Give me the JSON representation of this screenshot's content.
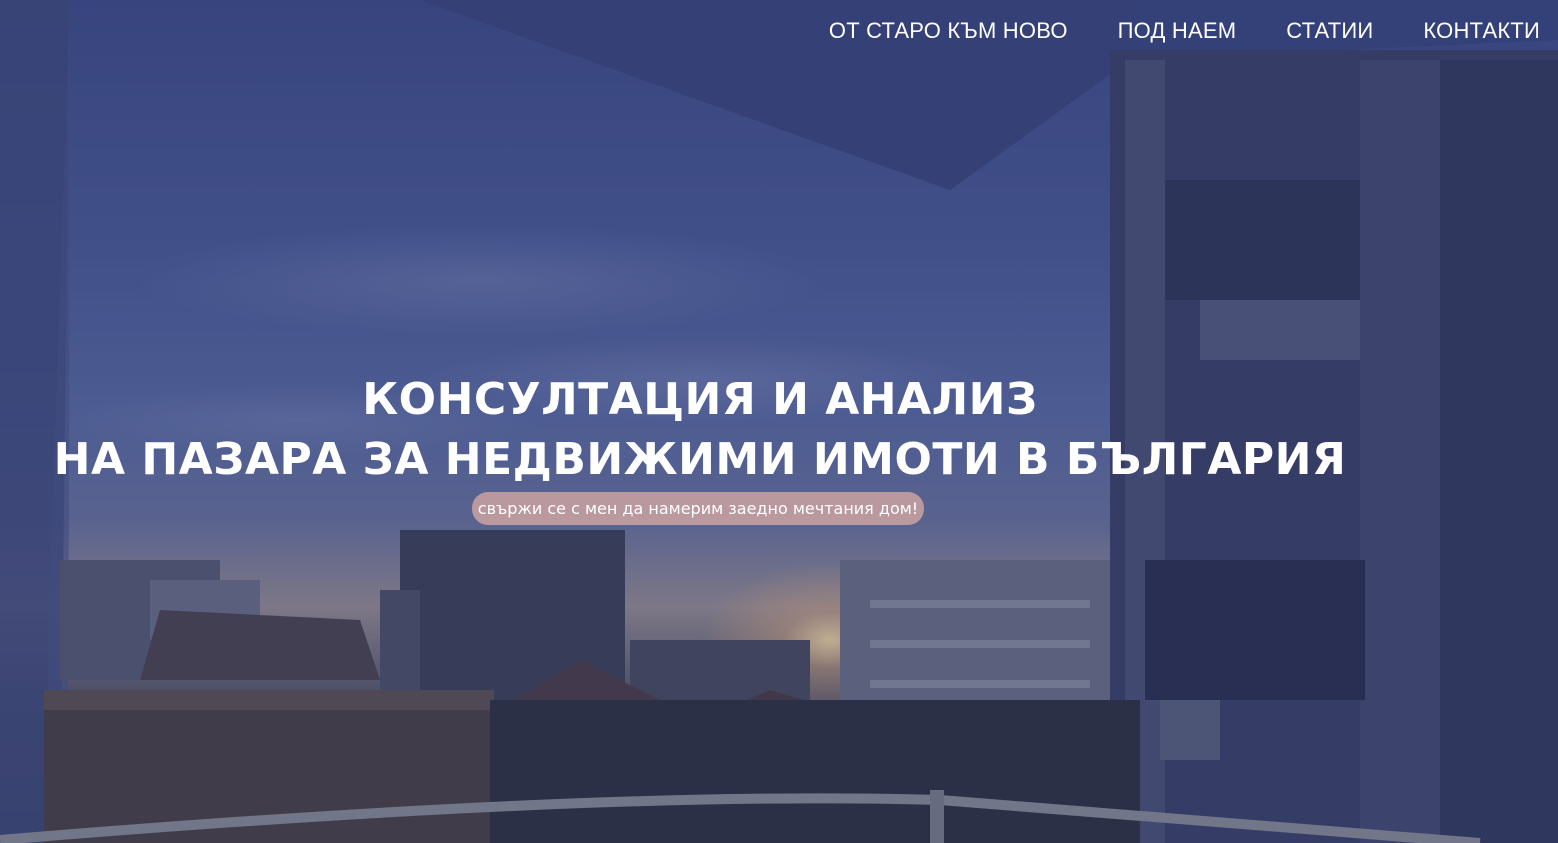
{
  "nav": {
    "items": [
      {
        "label": "ОТ СТАРО КЪМ НОВО"
      },
      {
        "label": "ПОД НАЕМ"
      },
      {
        "label": "СТАТИИ"
      },
      {
        "label": "КОНТАКТИ"
      }
    ]
  },
  "hero": {
    "headline_line1": "КОНСУЛТАЦИЯ И АНАЛИЗ",
    "headline_line2": "НА ПАЗАРА ЗА НЕДВИЖИМИ ИМОТИ В БЪЛГАРИЯ",
    "cta_label": "свържи се с мен да намерим заедно мечтания дом!"
  },
  "colors": {
    "sky_top": "#3d4a82",
    "cta_bg": "#c4a0a0",
    "text": "#ffffff"
  }
}
